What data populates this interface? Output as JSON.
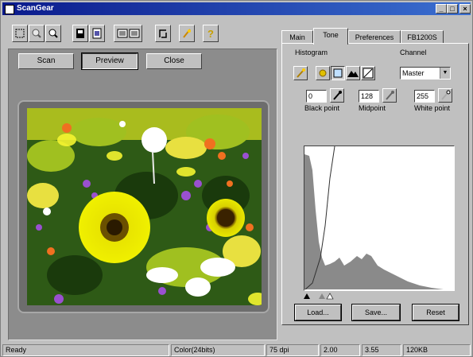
{
  "window": {
    "title": "ScanGear"
  },
  "toolbar": {
    "icons": [
      "select-area-icon",
      "zoom-in-icon",
      "zoom-out-icon",
      "auto-crop-icon",
      "image-type-icon",
      "scale-icon",
      "rotate-icon",
      "tone-icon",
      "help-icon"
    ]
  },
  "preview": {
    "buttons": {
      "scan": "Scan",
      "preview": "Preview",
      "close": "Close"
    }
  },
  "tabs": [
    {
      "label": "Main"
    },
    {
      "label": "Tone"
    },
    {
      "label": "Preferences"
    },
    {
      "label": "FB1200S"
    }
  ],
  "tone": {
    "histogram_label": "Histogram",
    "channel_label": "Channel",
    "channel_value": "Master",
    "black_point_value": "0",
    "black_point_label": "Black point",
    "midpoint_value": "128",
    "midpoint_label": "Midpoint",
    "white_point_value": "255",
    "white_point_label": "White point",
    "buttons": {
      "load": "Load...",
      "save": "Save...",
      "reset": "Reset"
    }
  },
  "status": {
    "ready": "Ready",
    "color": "Color(24bits)",
    "dpi": "75 dpi",
    "width": "2.00",
    "height": "3.55",
    "size": "120KB"
  }
}
